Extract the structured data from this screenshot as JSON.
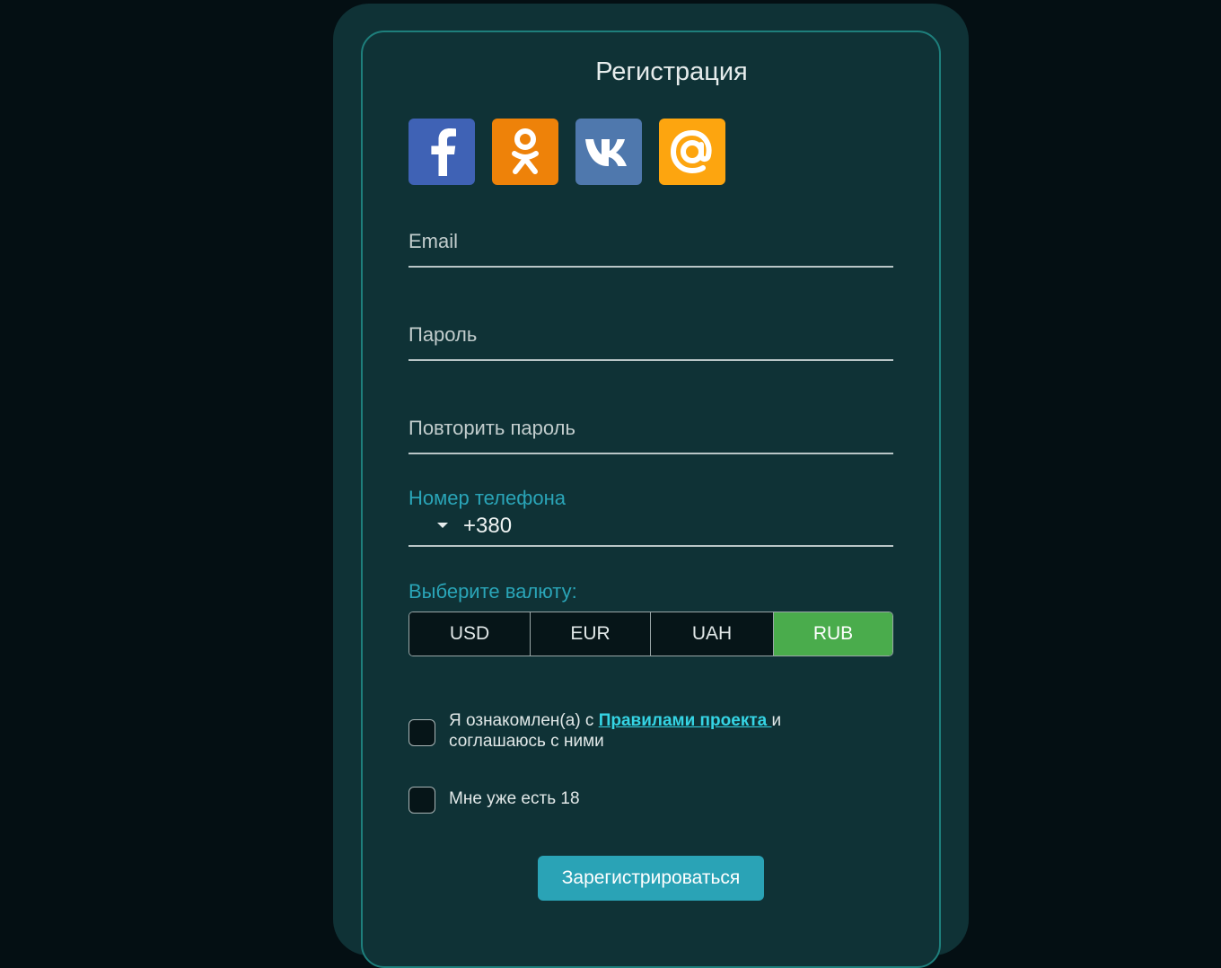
{
  "form": {
    "title": "Регистрация",
    "social": [
      {
        "name": "facebook-icon",
        "color": "#3f62b5"
      },
      {
        "name": "odnoklassniki-icon",
        "color": "#ee8209"
      },
      {
        "name": "vk-icon",
        "color": "#4f78ad"
      },
      {
        "name": "mail-ru-icon",
        "color": "#fda50f"
      }
    ],
    "email_label": "Email",
    "password_label": "Пароль",
    "repeat_password_label": "Повторить пароль",
    "phone_label": "Номер телефона",
    "phone_code": "+380",
    "currency_label": "Выберите валюту:",
    "currencies": [
      "USD",
      "EUR",
      "UAH",
      "RUB"
    ],
    "selected_currency": "RUB",
    "rules_text_before": "Я ознакомлен(а) с ",
    "rules_link": "Правилами проекта ",
    "rules_text_after": "и соглашаюсь с ними",
    "rules_checked": false,
    "age_text": "Мне уже есть 18",
    "age_checked": false,
    "submit_label": "Зарегистрироваться"
  },
  "colors": {
    "background": "#040f13",
    "card": "#0f3236",
    "accent": "#2aa3b6",
    "active_currency": "#4aac4c",
    "link": "#35d4e4"
  }
}
